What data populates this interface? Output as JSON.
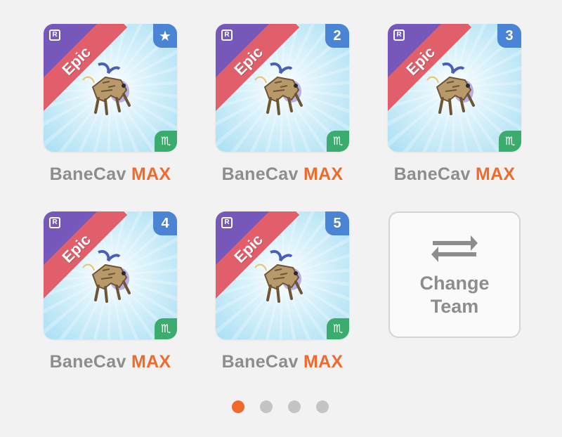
{
  "cards": [
    {
      "rarity": "Epic",
      "badge": "★",
      "name": "BaneCav",
      "level": "MAX",
      "sign": "♏"
    },
    {
      "rarity": "Epic",
      "badge": "2",
      "name": "BaneCav",
      "level": "MAX",
      "sign": "♏"
    },
    {
      "rarity": "Epic",
      "badge": "3",
      "name": "BaneCav",
      "level": "MAX",
      "sign": "♏"
    },
    {
      "rarity": "Epic",
      "badge": "4",
      "name": "BaneCav",
      "level": "MAX",
      "sign": "♏"
    },
    {
      "rarity": "Epic",
      "badge": "5",
      "name": "BaneCav",
      "level": "MAX",
      "sign": "♏"
    }
  ],
  "rank_badge": "R",
  "change_team": {
    "line1": "Change",
    "line2": "Team",
    "icon": "swap-arrows-icon"
  },
  "pagination": {
    "total": 4,
    "active": 1
  },
  "colors": {
    "accent": "#ef6b2c",
    "epic_ribbon": "#e05f6a",
    "rank_corner": "#7558b9",
    "number_badge": "#4a84d4",
    "sign_badge": "#3cab6e"
  }
}
